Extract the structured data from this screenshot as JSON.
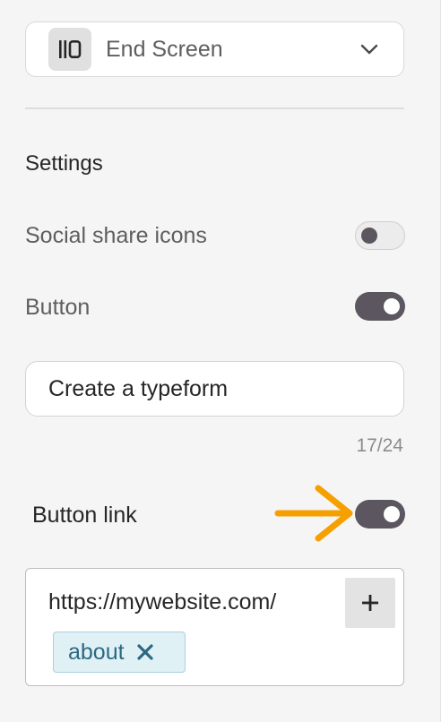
{
  "screen_type": {
    "label": "End Screen",
    "icon": "end-screen-icon"
  },
  "settings": {
    "title": "Settings",
    "social_share": {
      "label": "Social share icons",
      "enabled": false
    },
    "button": {
      "label": "Button",
      "enabled": true
    },
    "button_text": {
      "value": "Create a typeform",
      "counter": "17/24"
    },
    "button_link": {
      "label": "Button link",
      "enabled": true,
      "annotation_color": "#F6A000"
    },
    "link": {
      "url": "https://mywebsite.com/",
      "add_label": "+",
      "tag_label": "about",
      "tag_remove": "×"
    }
  },
  "colors": {
    "toggle_on": "#5B565F",
    "tag_background": "#E0F1F5",
    "tag_text": "#2B6883"
  }
}
